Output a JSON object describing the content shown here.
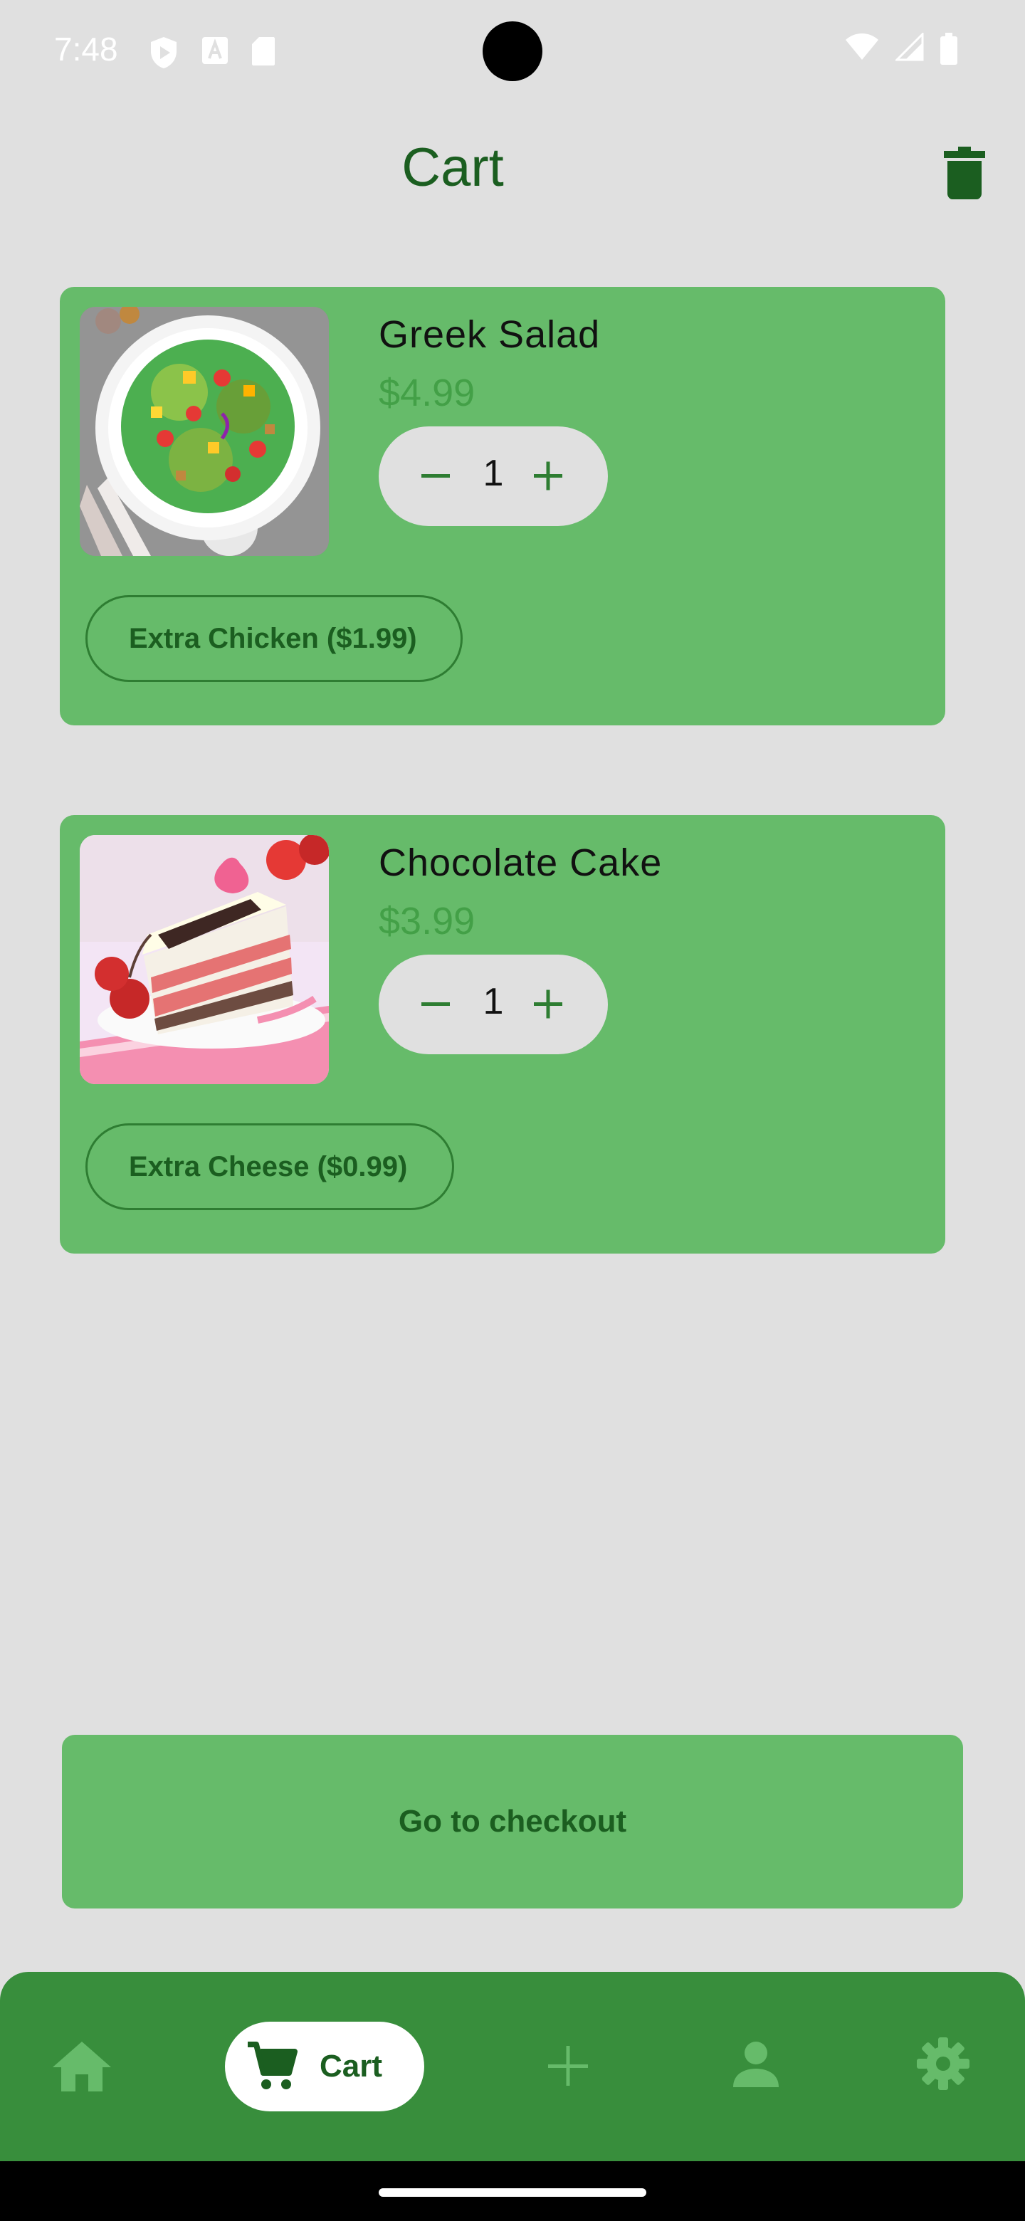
{
  "status_bar": {
    "time": "7:48",
    "icons_left": [
      "shield-icon",
      "font-icon",
      "sd-card-icon"
    ],
    "icons_right": [
      "wifi-icon",
      "signal-icon",
      "battery-icon"
    ]
  },
  "header": {
    "title": "Cart",
    "action_icon": "trash-icon"
  },
  "cart_items": [
    {
      "name": "Greek Salad",
      "price": "$4.99",
      "quantity": "1",
      "extra": "Extra Chicken ($1.99)",
      "image": "greek-salad-photo"
    },
    {
      "name": "Chocolate Cake",
      "price": "$3.99",
      "quantity": "1",
      "extra": "Extra Cheese ($0.99)",
      "image": "chocolate-cake-photo"
    }
  ],
  "checkout": {
    "label": "Go to checkout"
  },
  "bottom_nav": {
    "items": [
      {
        "icon": "home-icon"
      },
      {
        "icon": "cart-icon",
        "label": "Cart",
        "selected": true
      },
      {
        "icon": "add-icon"
      },
      {
        "icon": "person-icon"
      },
      {
        "icon": "gear-icon"
      }
    ]
  },
  "colors": {
    "background": "#e0e0e0",
    "card": "#66bb6a",
    "nav": "#388e3c",
    "accent_dark": "#1b5e20",
    "price": "#43a047"
  }
}
